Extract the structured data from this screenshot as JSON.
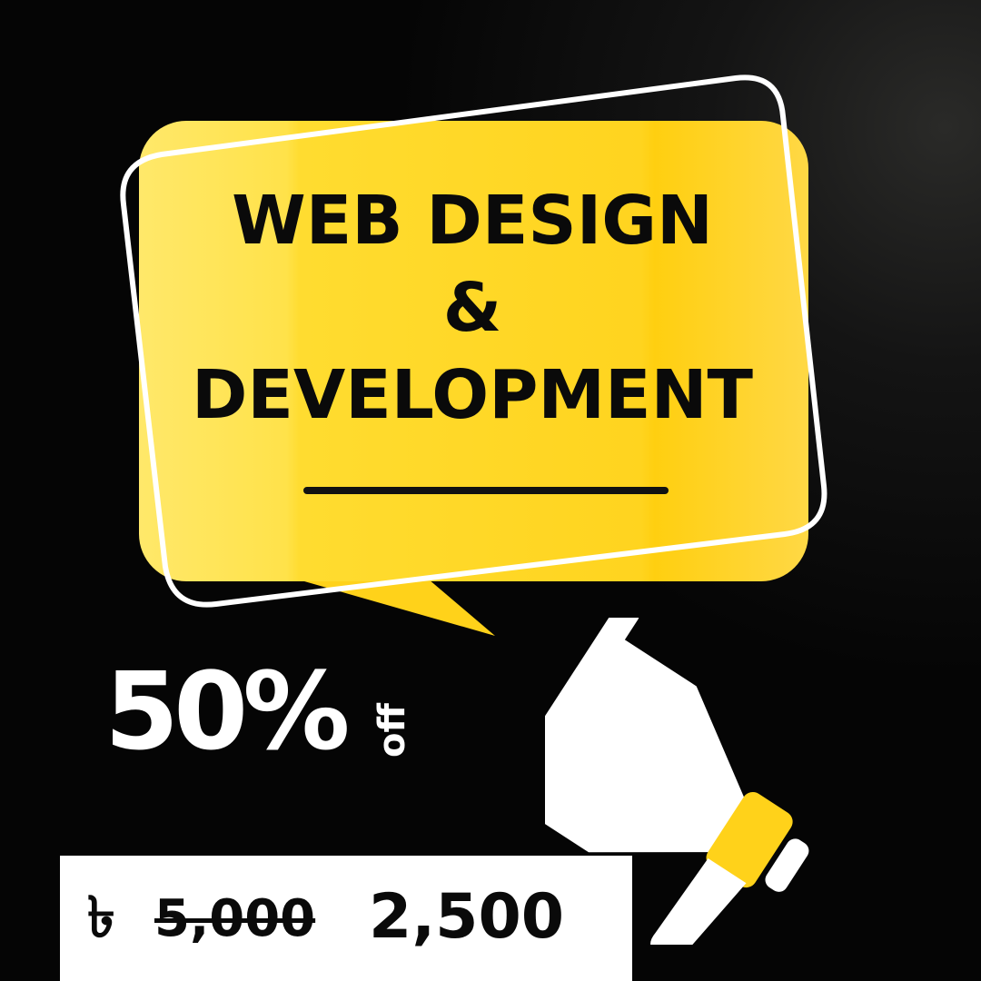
{
  "headline": {
    "line1": "WEB DESIGN",
    "line2": "&",
    "line3": "DEVELOPMENT"
  },
  "offer": {
    "percent": "50%",
    "suffix": "off"
  },
  "pricing": {
    "currency_symbol": "৳",
    "original_price": "5,000",
    "discounted_price": "2,500"
  },
  "icons": {
    "speech_bubble": "speech-bubble-icon",
    "megaphone": "megaphone-icon"
  },
  "colors": {
    "accent_yellow": "#ffd21a",
    "background": "#050505",
    "text_dark": "#0a0a0a",
    "text_light": "#ffffff"
  }
}
